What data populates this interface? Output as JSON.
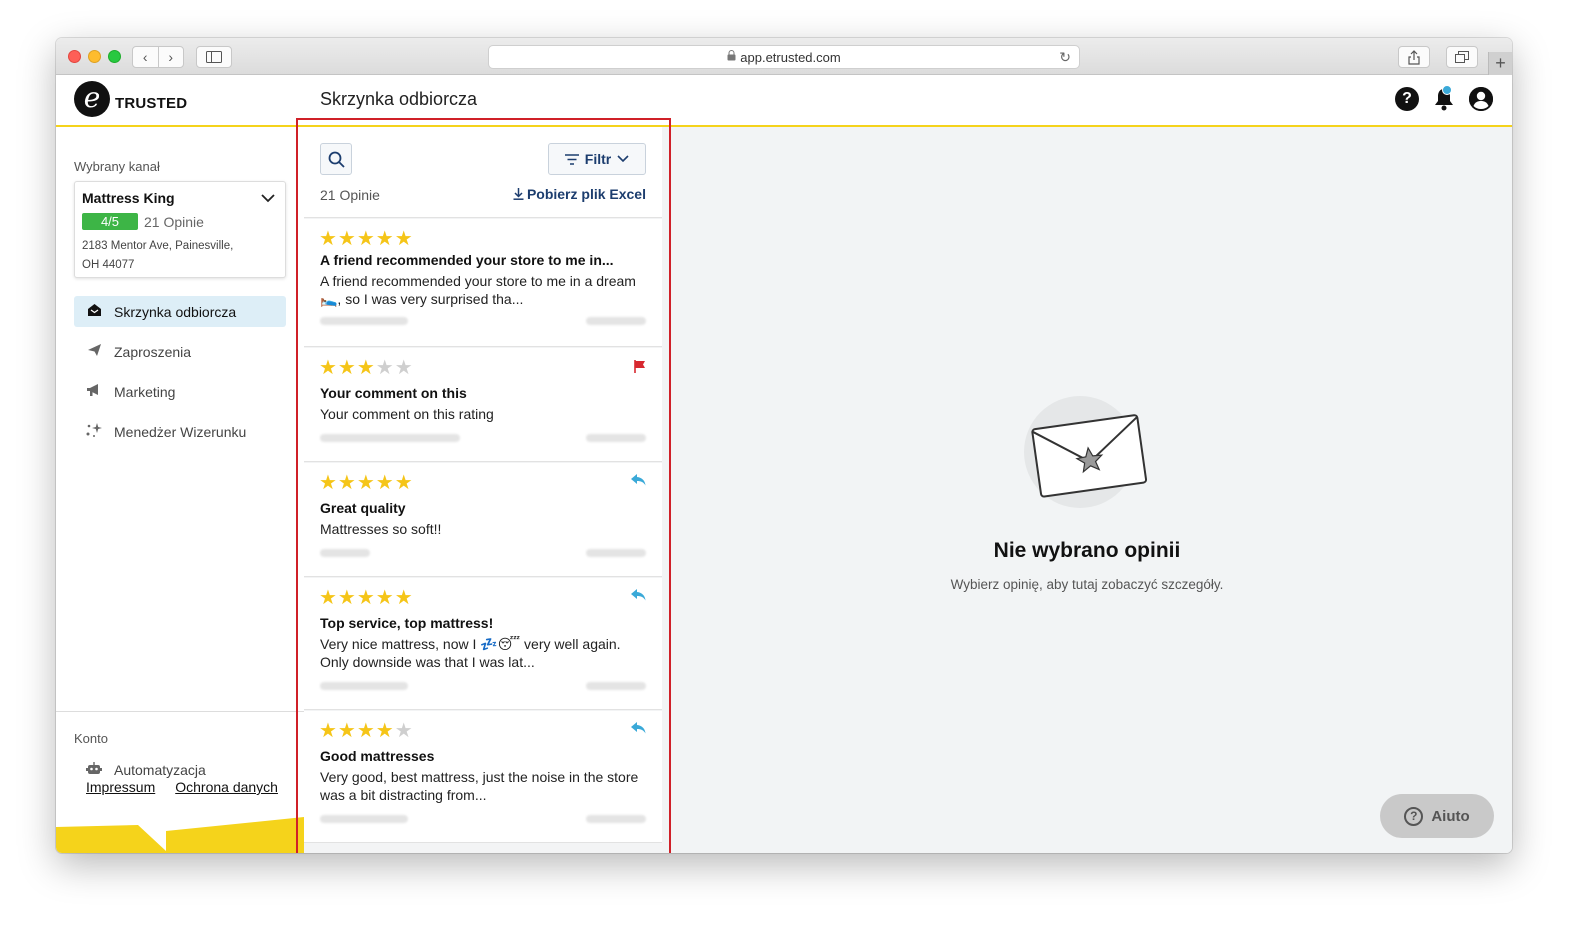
{
  "browser": {
    "url": "app.etrusted.com"
  },
  "header": {
    "logo_text": "TRUSTED",
    "logo_mark": "e",
    "page_title": "Skrzynka odbiorcza",
    "help_glyph": "?"
  },
  "sidebar": {
    "channel_label": "Wybrany kanał",
    "channel": {
      "name": "Mattress King",
      "rating": "4/5",
      "count": "21 Opinie",
      "address": "2183 Mentor Ave, Painesville, OH 44077"
    },
    "items": [
      {
        "label": "Skrzynka odbiorcza",
        "icon": "inbox-icon"
      },
      {
        "label": "Zaproszenia",
        "icon": "send-icon"
      },
      {
        "label": "Marketing",
        "icon": "megaphone-icon"
      },
      {
        "label": "Menedżer Wizerunku",
        "icon": "sparkle-icon"
      }
    ],
    "account_label": "Konto",
    "account_items": [
      {
        "label": "Automatyzacja",
        "icon": "robot-icon"
      }
    ],
    "footer": {
      "impressum": "Impressum",
      "privacy": "Ochrona danych"
    },
    "brand_color": "#f5d31b"
  },
  "list": {
    "filter_label": "Filtr",
    "count": "21 Opinie",
    "excel_label": "Pobierz plik Excel",
    "reviews": [
      {
        "stars": 5,
        "title": "A friend recommended your store to me in...",
        "text": "A friend recommended your store to me in a dream 🛌, so I was very surprised tha...",
        "status": "none"
      },
      {
        "stars": 3,
        "title": "Your comment on this",
        "text": "Your comment on this rating",
        "status": "flagged"
      },
      {
        "stars": 5,
        "title": "Great quality",
        "text": "Mattresses so soft!!",
        "status": "replied"
      },
      {
        "stars": 5,
        "title": "Top service, top mattress!",
        "text": "Very nice mattress, now I 💤😴 very well again. Only downside was that I was lat...",
        "status": "replied"
      },
      {
        "stars": 4,
        "title": "Good mattresses",
        "text": "Very good, best mattress, just the noise in the store was a bit distracting from...",
        "status": "replied"
      }
    ]
  },
  "detail": {
    "empty_title": "Nie wybrano opinii",
    "empty_subtitle": "Wybierz opinię, aby tutaj zobaczyć szczegóły.",
    "help_label": "Aiuto"
  },
  "colors": {
    "star": "#f5c518",
    "star_empty": "#cfcfcf",
    "rating_badge": "#3db546",
    "link": "#1c3d6e",
    "flag": "#d7282f",
    "reply": "#3aa9d8",
    "highlight": "#d02028"
  }
}
